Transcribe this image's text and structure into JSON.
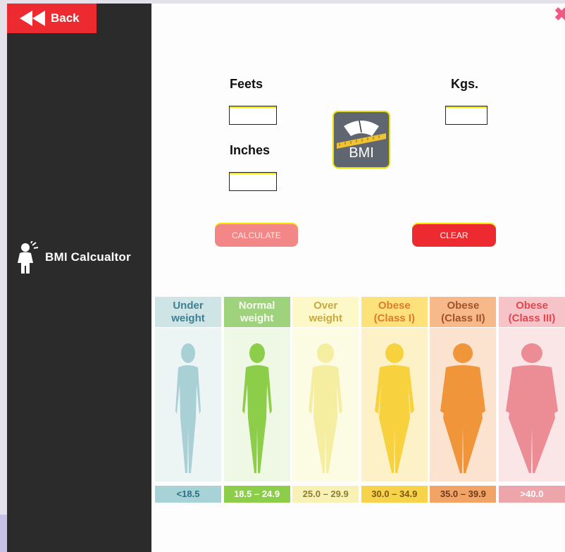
{
  "sidebar": {
    "back_label": "Back",
    "brand_label": "BMI Calcualtor"
  },
  "form": {
    "feet_label": "Feets",
    "inches_label": "Inches",
    "kgs_label": "Kgs.",
    "feet_value": "",
    "inches_value": "",
    "kgs_value": "",
    "bmi_icon_label": "BMI",
    "calculate_label": "CALCULATE",
    "clear_label": "CLEAR"
  },
  "chart": {
    "categories": [
      {
        "line1": "Under",
        "line2": "weight",
        "range": "<18.5",
        "head_bg": "#cfe4e5",
        "head_fg": "#3d7f95",
        "body_bg": "#ecf4f4",
        "figure_color": "#a9d0d5",
        "foot_bg": "#a7d2d6",
        "foot_fg": "#2f6f86"
      },
      {
        "line1": "Normal",
        "line2": "weight",
        "range": "18.5 – 24.9",
        "head_bg": "#9fd27c",
        "head_fg": "#f7fbef",
        "body_bg": "#eef8e4",
        "figure_color": "#8ccd4a",
        "foot_bg": "#8ccd4a",
        "foot_fg": "#ffffff"
      },
      {
        "line1": "Over",
        "line2": "weight",
        "range": "25.0 – 29.9",
        "head_bg": "#fdf8c8",
        "head_fg": "#c9a93e",
        "body_bg": "#fcfbe3",
        "figure_color": "#f5eea0",
        "foot_bg": "#f7f1b5",
        "foot_fg": "#8d7b35"
      },
      {
        "line1": "Obese",
        "line2": "(Class I)",
        "range": "30.0 – 34.9",
        "head_bg": "#fde17a",
        "head_fg": "#e07a2c",
        "body_bg": "#fdf2c7",
        "figure_color": "#f8d23e",
        "foot_bg": "#f7d24b",
        "foot_fg": "#7a5a10"
      },
      {
        "line1": "Obese",
        "line2": "(Class II)",
        "range": "35.0 – 39.9",
        "head_bg": "#f8b98a",
        "head_fg": "#a2522a",
        "body_bg": "#fbe3cf",
        "figure_color": "#f0953a",
        "foot_bg": "#f1a466",
        "foot_fg": "#6f3a1c"
      },
      {
        "line1": "Obese",
        "line2": "(Class III)",
        "range": ">40.0",
        "head_bg": "#f6c4c8",
        "head_fg": "#e1474f",
        "body_bg": "#fbe6e7",
        "figure_color": "#ec8c94",
        "foot_bg": "#eba5ab",
        "foot_fg": "#ffffff"
      }
    ]
  }
}
